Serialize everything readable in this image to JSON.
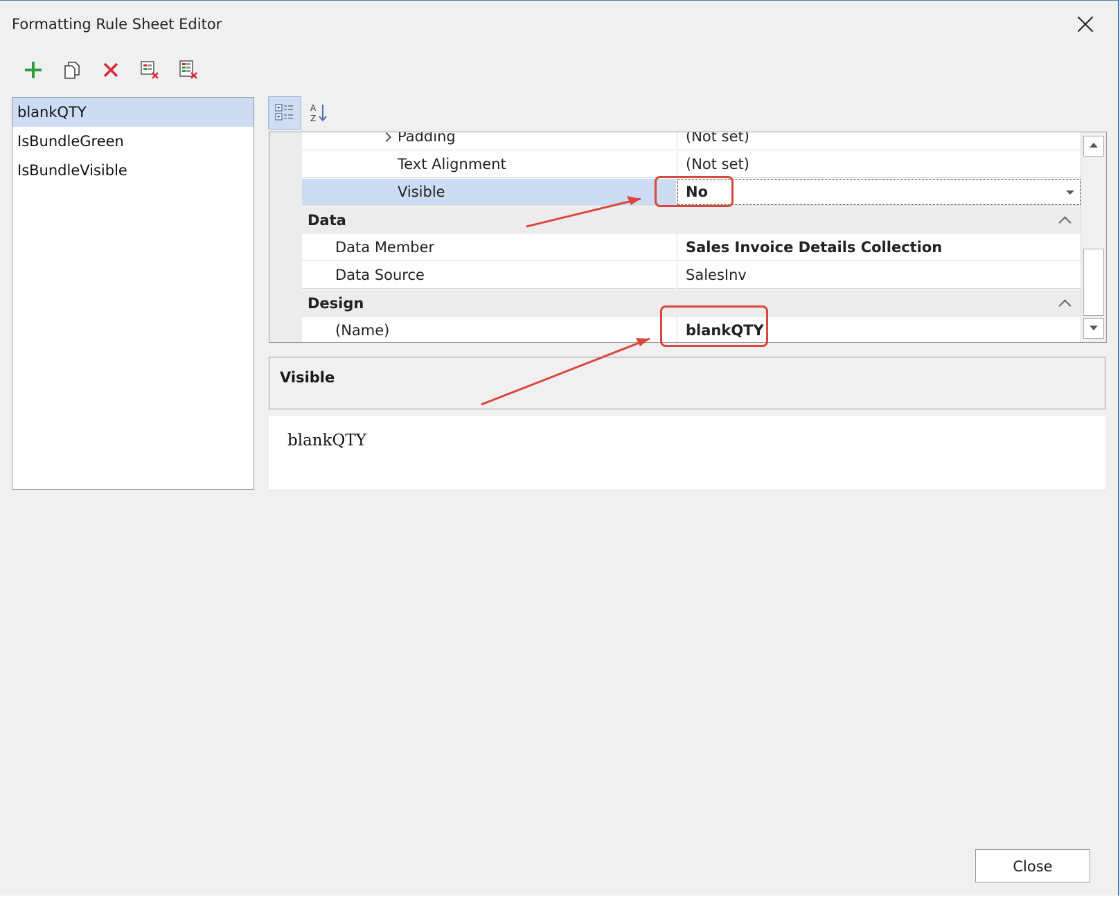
{
  "window": {
    "title": "Formatting Rule Sheet Editor"
  },
  "toolbar": {
    "icons": [
      "add-icon",
      "copy-icon",
      "delete-icon",
      "remove-unused-icon",
      "purge-icon"
    ]
  },
  "rules": [
    {
      "label": "blankQTY",
      "selected": true
    },
    {
      "label": "IsBundleGreen",
      "selected": false
    },
    {
      "label": "IsBundleVisible",
      "selected": false
    }
  ],
  "property_grid": {
    "view_icons": [
      "categorized-view-icon",
      "alphabetical-sort-icon"
    ],
    "rows": {
      "padding": {
        "name": "Padding",
        "value": "(Not set)"
      },
      "text_alignment": {
        "name": "Text Alignment",
        "value": "(Not set)"
      },
      "visible": {
        "name": "Visible",
        "value": "No"
      },
      "data_category": "Data",
      "data_member": {
        "name": "Data Member",
        "value": "Sales Invoice Details Collection"
      },
      "data_source": {
        "name": "Data Source",
        "value": "SalesInv"
      },
      "design_category": "Design",
      "name_prop": {
        "name": "(Name)",
        "value": "blankQTY"
      }
    }
  },
  "description": {
    "title": "Visible"
  },
  "preview": {
    "text": "blankQTY"
  },
  "footer": {
    "close_label": "Close"
  },
  "colors": {
    "annotation": "#d9463b",
    "selection": "#cddcf3",
    "accent": "#4a78b8"
  }
}
